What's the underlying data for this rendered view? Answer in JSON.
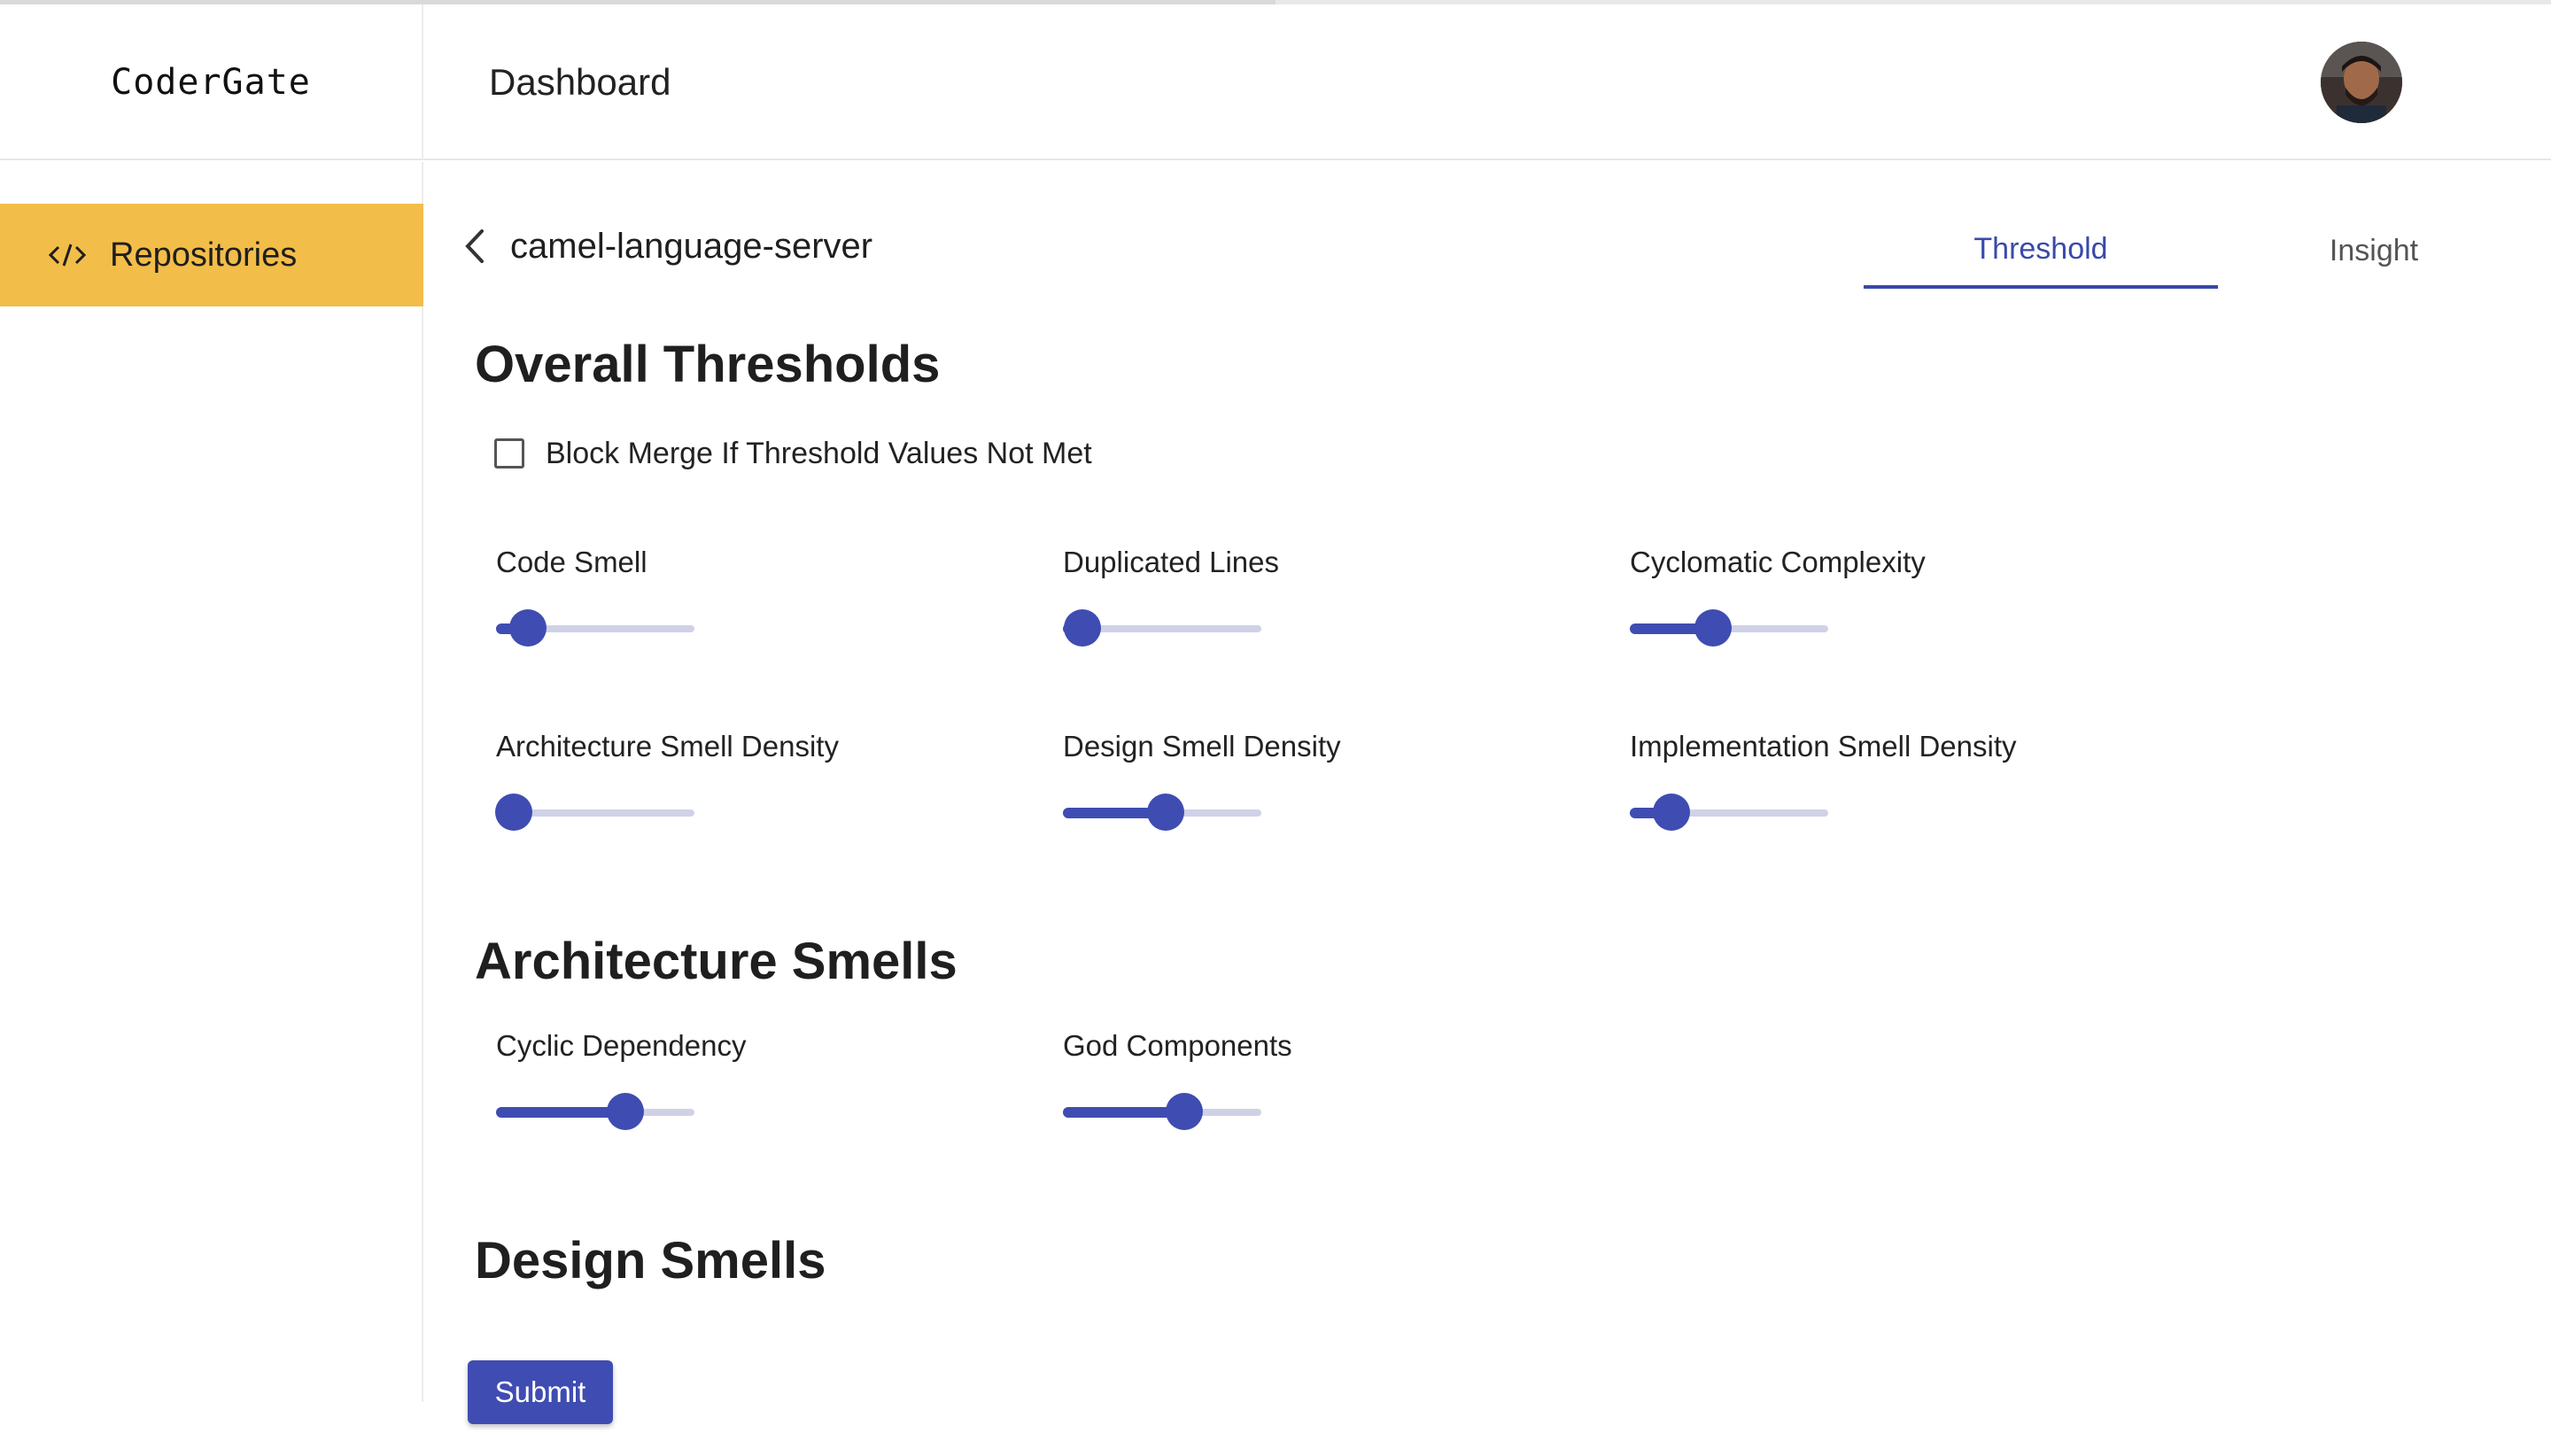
{
  "header": {
    "brand": "CoderGate",
    "page_title": "Dashboard"
  },
  "sidebar": {
    "items": [
      {
        "label": "Repositories",
        "icon": "code-icon",
        "active": true
      }
    ]
  },
  "repo": {
    "name": "camel-language-server"
  },
  "tabs": [
    {
      "label": "Threshold",
      "active": true
    },
    {
      "label": "Insight",
      "active": false
    }
  ],
  "overall": {
    "title": "Overall Thresholds",
    "block_merge_label": "Block Merge If Threshold Values Not Met",
    "block_merge_checked": false,
    "sliders": [
      {
        "label": "Code Smell",
        "value": 0.16
      },
      {
        "label": "Duplicated Lines",
        "value": 0.1
      },
      {
        "label": "Cyclomatic Complexity",
        "value": 0.42
      },
      {
        "label": "Architecture Smell Density",
        "value": 0.09
      },
      {
        "label": "Design Smell Density",
        "value": 0.52
      },
      {
        "label": "Implementation Smell Density",
        "value": 0.21
      }
    ]
  },
  "architecture": {
    "title": "Architecture Smells",
    "sliders": [
      {
        "label": "Cyclic Dependency",
        "value": 0.65
      },
      {
        "label": "God Components",
        "value": 0.61
      }
    ]
  },
  "design": {
    "title": "Design Smells"
  },
  "actions": {
    "submit_label": "Submit"
  },
  "colors": {
    "accent": "#3f4cb2",
    "sidebar_active": "#f2bd49",
    "rail": "#cfd2e6"
  }
}
